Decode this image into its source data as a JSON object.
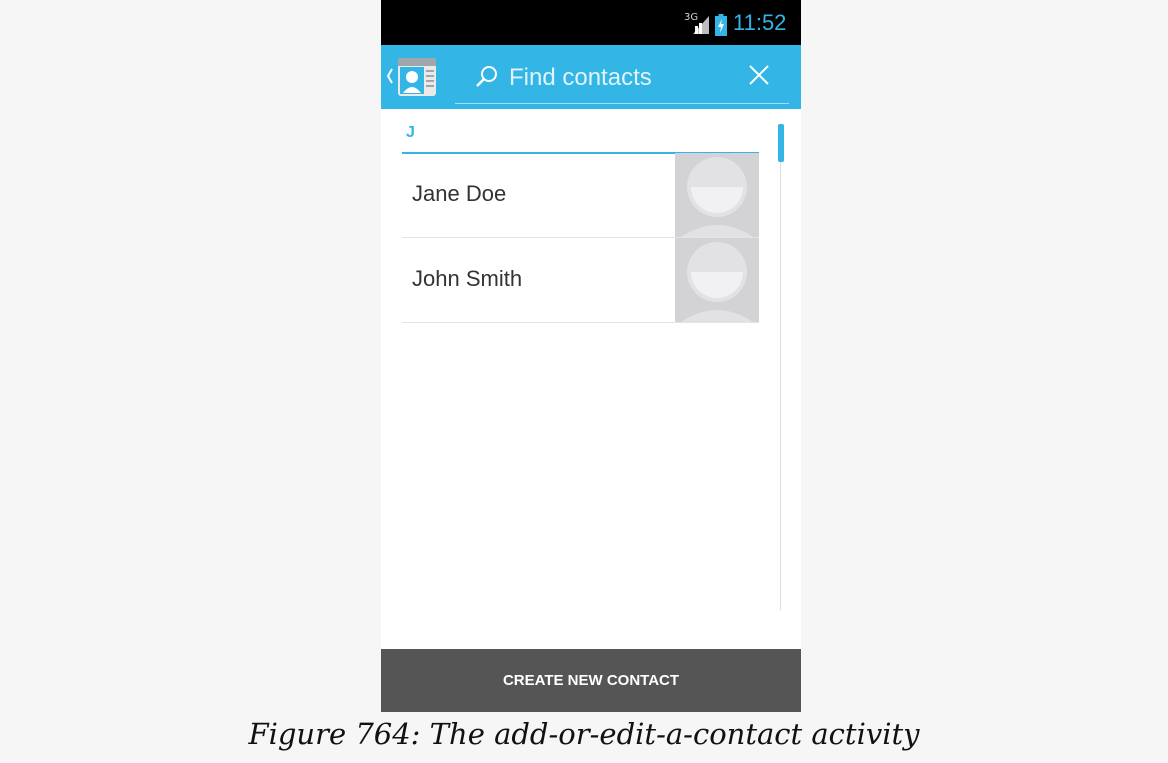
{
  "status_bar": {
    "network": "3G",
    "time": "11:52",
    "signal_icon": "signal-icon",
    "battery_icon": "battery-charging-icon"
  },
  "action_bar": {
    "up_icon": "chevron-left-icon",
    "app_icon": "contacts-app-icon",
    "search": {
      "placeholder": "Find contacts",
      "value": "",
      "icon": "search-icon"
    },
    "clear_icon": "close-icon",
    "color": "#33b5e5"
  },
  "contacts": {
    "section_letter": "J",
    "items": [
      {
        "name": "Jane Doe",
        "photo_icon": "default-avatar-icon"
      },
      {
        "name": "John Smith",
        "photo_icon": "default-avatar-icon"
      }
    ]
  },
  "bottom_button": {
    "label": "CREATE NEW CONTACT"
  },
  "caption": "Figure 764: The add-or-edit-a-contact activity"
}
